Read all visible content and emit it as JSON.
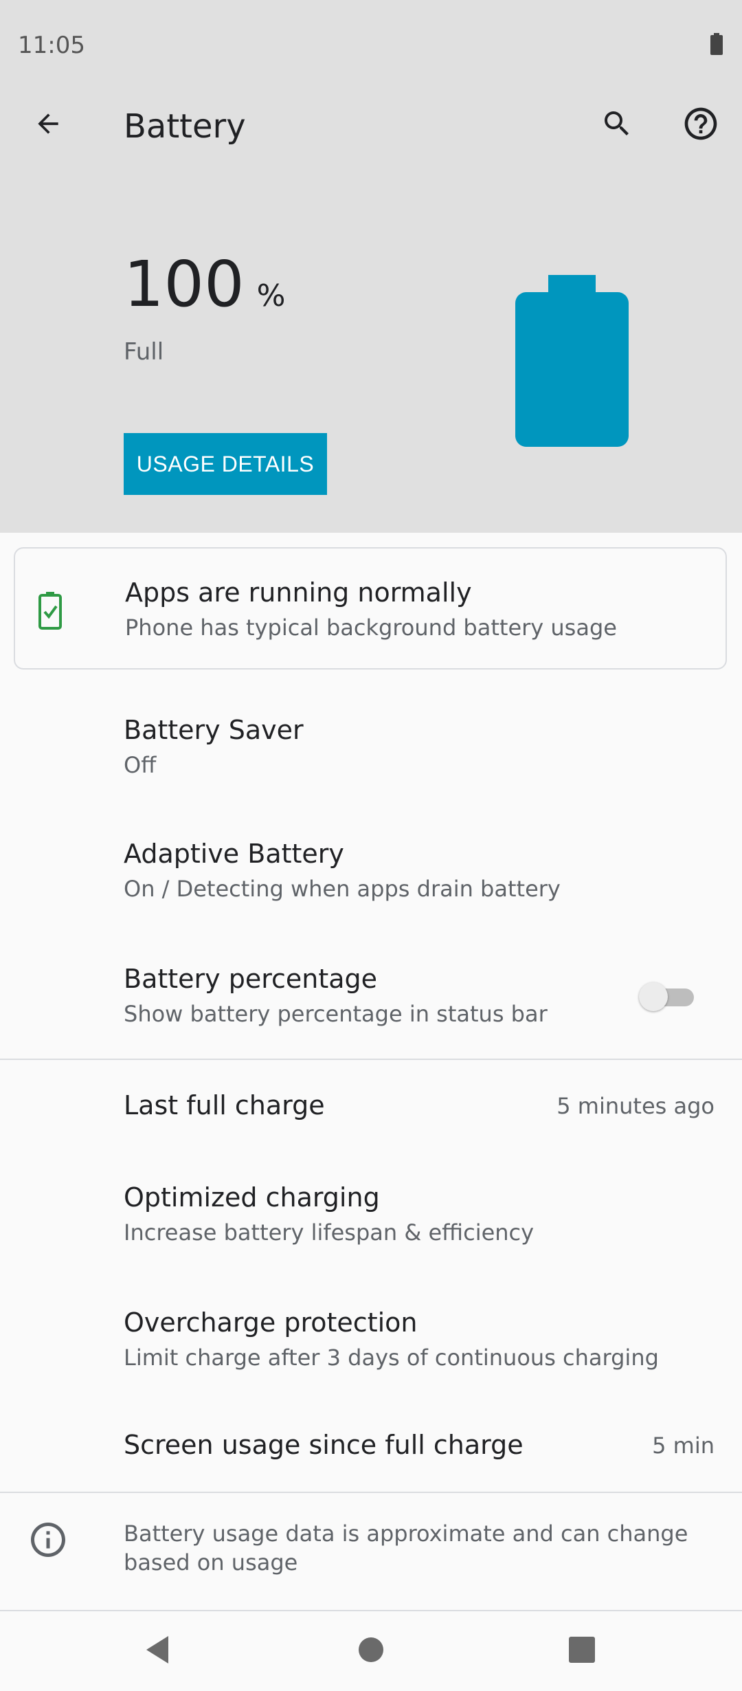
{
  "status_bar": {
    "time": "11:05"
  },
  "toolbar": {
    "title": "Battery"
  },
  "summary": {
    "level": "100",
    "unit": "%",
    "state": "Full",
    "usage_button": "USAGE DETAILS"
  },
  "card": {
    "title": "Apps are running normally",
    "subtitle": "Phone has typical background battery usage"
  },
  "settings": [
    {
      "title": "Battery Saver",
      "subtitle": "Off"
    },
    {
      "title": "Adaptive Battery",
      "subtitle": "On / Detecting when apps drain battery"
    },
    {
      "title": "Battery percentage",
      "subtitle": "Show battery percentage in status bar",
      "toggle_on": false
    }
  ],
  "info_rows": [
    {
      "title": "Last full charge",
      "value": "5 minutes ago"
    },
    {
      "title": "Optimized charging",
      "subtitle": "Increase battery lifespan & efficiency"
    },
    {
      "title": "Overcharge protection",
      "subtitle": "Limit charge after 3 days of continuous charging"
    },
    {
      "title": "Screen usage since full charge",
      "value": "5 min"
    }
  ],
  "footer_note": "Battery usage data is approximate and can change based on usage",
  "colors": {
    "accent": "#0096be",
    "check_green": "#2e9a44",
    "header_bg": "#e0e0e0"
  }
}
